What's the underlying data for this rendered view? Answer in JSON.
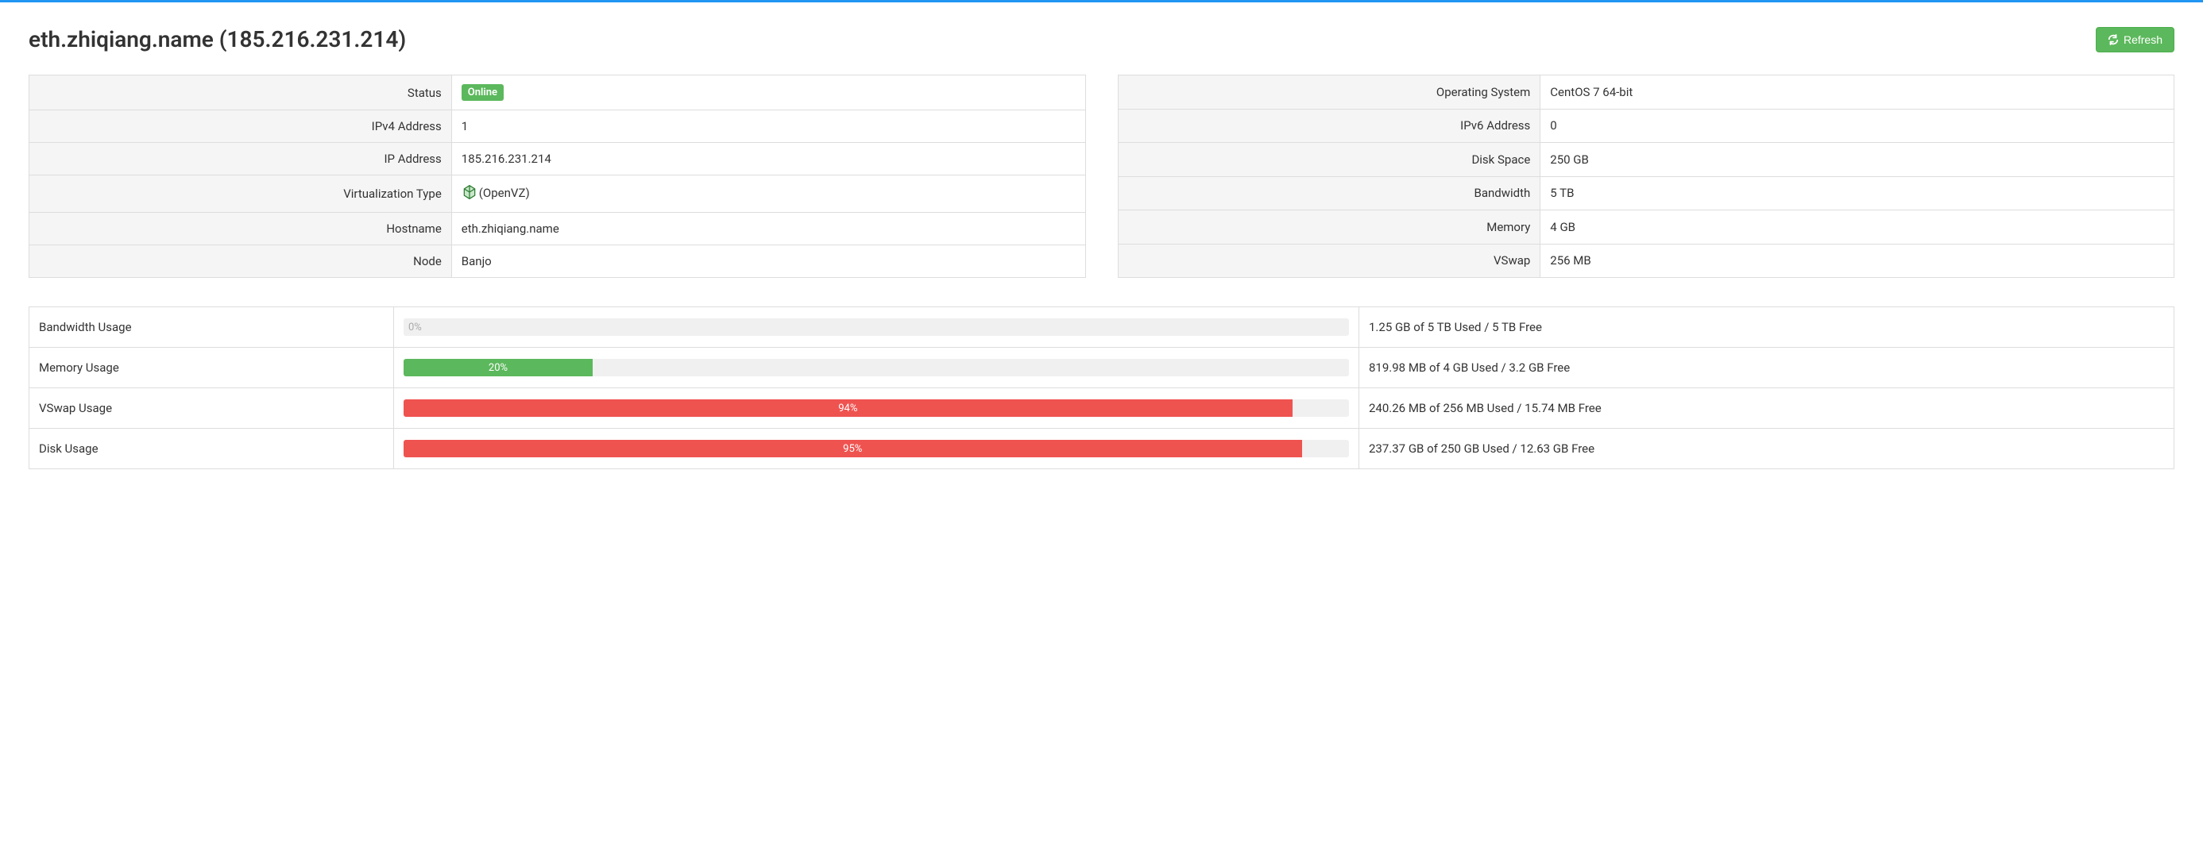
{
  "header": {
    "title": "eth.zhiqiang.name (185.216.231.214)",
    "refresh_label": "Refresh"
  },
  "left_table": [
    {
      "label": "Status",
      "value": "Online",
      "badge": true
    },
    {
      "label": "IPv4 Address",
      "value": "1"
    },
    {
      "label": "IP Address",
      "value": "185.216.231.214"
    },
    {
      "label": "Virtualization Type",
      "value": "(OpenVZ)",
      "virt_icon": true
    },
    {
      "label": "Hostname",
      "value": "eth.zhiqiang.name"
    },
    {
      "label": "Node",
      "value": "Banjo"
    }
  ],
  "right_table": [
    {
      "label": "Operating System",
      "value": "CentOS 7 64-bit"
    },
    {
      "label": "IPv6 Address",
      "value": "0"
    },
    {
      "label": "Disk Space",
      "value": "250 GB"
    },
    {
      "label": "Bandwidth",
      "value": "5 TB"
    },
    {
      "label": "Memory",
      "value": "4 GB"
    },
    {
      "label": "VSwap",
      "value": "256 MB"
    }
  ],
  "usage": [
    {
      "label": "Bandwidth Usage",
      "percent": 0,
      "percent_label": "0%",
      "color": "gray",
      "text": "1.25 GB of 5 TB Used / 5 TB Free"
    },
    {
      "label": "Memory Usage",
      "percent": 20,
      "percent_label": "20%",
      "color": "green",
      "text": "819.98 MB of 4 GB Used / 3.2 GB Free"
    },
    {
      "label": "VSwap Usage",
      "percent": 94,
      "percent_label": "94%",
      "color": "red",
      "text": "240.26 MB of 256 MB Used / 15.74 MB Free"
    },
    {
      "label": "Disk Usage",
      "percent": 95,
      "percent_label": "95%",
      "color": "red",
      "text": "237.37 GB of 250 GB Used / 12.63 GB Free"
    }
  ]
}
